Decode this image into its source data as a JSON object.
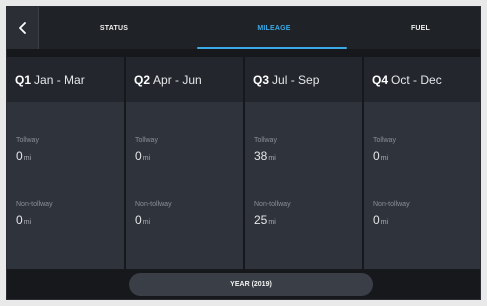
{
  "tabs": [
    {
      "label": "STATUS"
    },
    {
      "label": "MILEAGE"
    },
    {
      "label": "FUEL"
    }
  ],
  "quarters": [
    {
      "q": "Q1",
      "range": "Jan - Mar",
      "tollway_label": "Tollway",
      "tollway_value": "0",
      "non_tollway_label": "Non-tollway",
      "non_tollway_value": "0",
      "unit": "mi"
    },
    {
      "q": "Q2",
      "range": "Apr - Jun",
      "tollway_label": "Tollway",
      "tollway_value": "0",
      "non_tollway_label": "Non-tollway",
      "non_tollway_value": "0",
      "unit": "mi"
    },
    {
      "q": "Q3",
      "range": "Jul - Sep",
      "tollway_label": "Tollway",
      "tollway_value": "38",
      "non_tollway_label": "Non-tollway",
      "non_tollway_value": "25",
      "unit": "mi"
    },
    {
      "q": "Q4",
      "range": "Oct - Dec",
      "tollway_label": "Tollway",
      "tollway_value": "0",
      "non_tollway_label": "Non-tollway",
      "non_tollway_value": "0",
      "unit": "mi"
    }
  ],
  "year_button": {
    "label": "YEAR (2019)"
  },
  "icons": {
    "back": "chevron-left-icon"
  },
  "colors": {
    "accent": "#3ba9e6",
    "background": "#16181c",
    "card": "#2f343c",
    "card_header": "#23272d"
  }
}
